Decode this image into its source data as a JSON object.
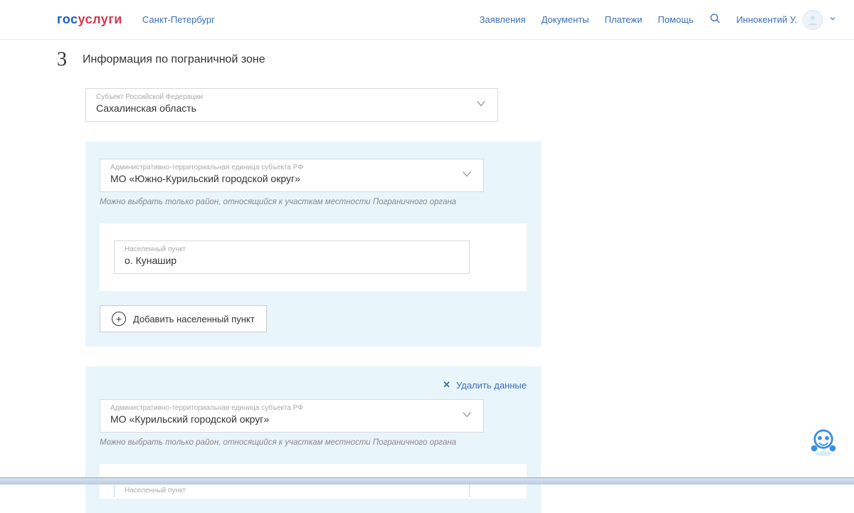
{
  "header": {
    "logo_part1": "гос",
    "logo_part2": "услуги",
    "city": "Санкт-Петербург",
    "nav": {
      "applications": "Заявления",
      "documents": "Документы",
      "payments": "Платежи",
      "help": "Помощь"
    },
    "user_name": "Иннокентий У."
  },
  "step": {
    "number": "3",
    "title": "Информация по пограничной зоне"
  },
  "subject": {
    "label": "Субъект Российской Федерации",
    "value": "Сахалинская область"
  },
  "block1": {
    "adm": {
      "label": "Административно-территориальная единица субъекта РФ",
      "value": "МО «Южно-Курильский городской округ»"
    },
    "hint": "Можно выбрать только район, относящийся к участкам местности Пограничного органа",
    "settle": {
      "label": "Населенный пункт",
      "value": "о. Кунашир"
    },
    "add_btn": "Добавить населенный пункт"
  },
  "block2": {
    "delete_link": "Удалить данные",
    "adm": {
      "label": "Административно-территориальная единица субъекта РФ",
      "value": "МО «Курильский городской округ»"
    },
    "hint": "Можно выбрать только район, относящийся к участкам местности Пограничного органа",
    "settle_label": "Населенный пункт"
  }
}
